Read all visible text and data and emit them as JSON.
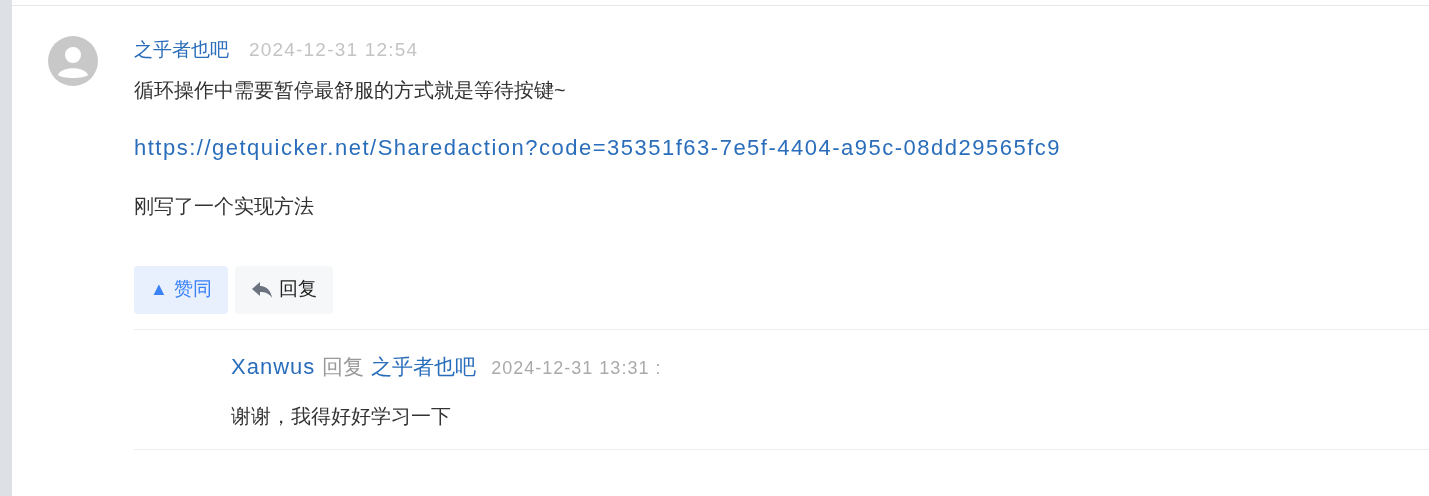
{
  "comment": {
    "author": "之乎者也吧",
    "time": "2024-12-31 12:54",
    "paragraphs": [
      {
        "kind": "text",
        "text": "循环操作中需要暂停最舒服的方式就是等待按键~"
      },
      {
        "kind": "link",
        "text": "https://getquicker.net/Sharedaction?code=35351f63-7e5f-4404-a95c-08dd29565fc9"
      },
      {
        "kind": "text",
        "text": "刚写了一个实现方法"
      }
    ],
    "actions": [
      {
        "kind": "upvote",
        "glyph": "▲",
        "label": "赞同",
        "selected": true
      },
      {
        "kind": "reply",
        "label": "回复",
        "selected": false
      }
    ],
    "replies": [
      {
        "author": "Xanwus",
        "verb": "回复",
        "target": "之乎者也吧",
        "time": "2024-12-31 13:31 :",
        "text": "谢谢，我得好好学习一下"
      }
    ]
  }
}
